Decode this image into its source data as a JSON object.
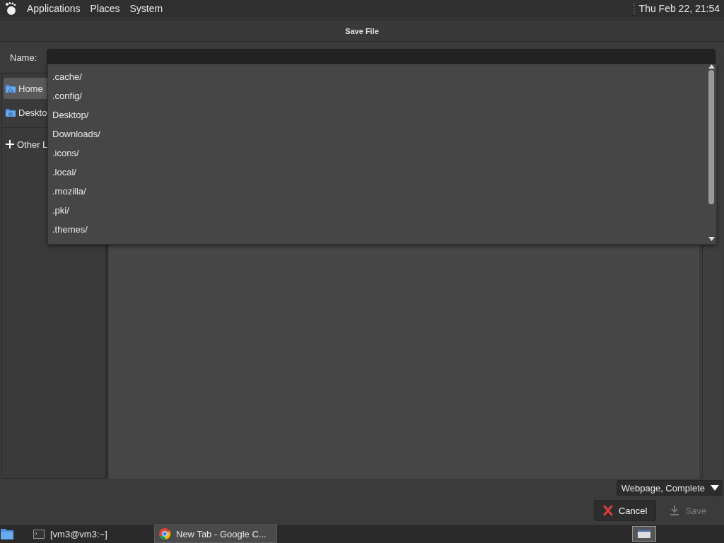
{
  "top_panel": {
    "menus": [
      "Applications",
      "Places",
      "System"
    ],
    "clock": "Thu Feb 22, 21:54"
  },
  "dialog": {
    "title": "Save File",
    "name_label": "Name:",
    "completions": [
      ".cache/",
      ".config/",
      "Desktop/",
      "Downloads/",
      ".icons/",
      ".local/",
      ".mozilla/",
      ".pki/",
      ".themes/"
    ],
    "sidebar": [
      {
        "label": "Home",
        "kind": "home",
        "selected": true
      },
      {
        "label": "Deskto",
        "kind": "desktop",
        "selected": false
      },
      {
        "label": "Other L",
        "kind": "other",
        "selected": false
      }
    ],
    "file_type": "Webpage, Complete",
    "buttons": [
      {
        "label": "Cancel",
        "kind": "cancel",
        "disabled": false
      },
      {
        "label": "Save",
        "kind": "save",
        "disabled": true
      }
    ]
  },
  "taskbar": {
    "tasks": [
      {
        "label": "[vm3@vm3:~]",
        "kind": "terminal",
        "selected": false
      },
      {
        "label": "New Tab - Google C...",
        "kind": "browser",
        "selected": true
      }
    ]
  }
}
